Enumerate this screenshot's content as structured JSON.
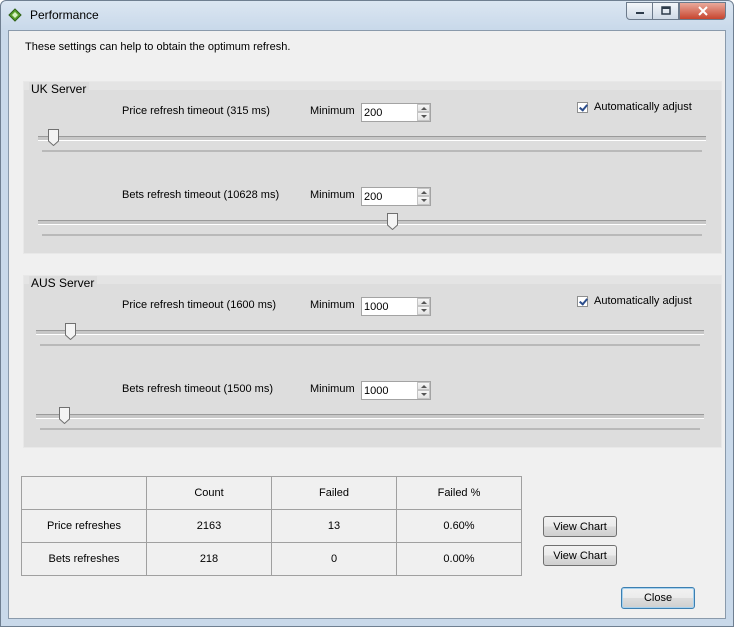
{
  "window": {
    "title": "Performance",
    "icon": "app-diamond-icon"
  },
  "intro_text": "These settings can help to obtain the optimum refresh.",
  "uk_server": {
    "title": "UK Server",
    "price": {
      "label": "Price refresh timeout (315 ms)",
      "min_label": "Minimum",
      "min_value": "200",
      "slider_fraction": 0.01
    },
    "bets": {
      "label": "Bets refresh timeout (10628 ms)",
      "min_label": "Minimum",
      "min_value": "200",
      "slider_fraction": 0.53
    },
    "auto_adjust": {
      "label": "Automatically adjust",
      "checked": true
    }
  },
  "aus_server": {
    "title": "AUS Server",
    "price": {
      "label": "Price refresh timeout (1600 ms)",
      "min_label": "Minimum",
      "min_value": "1000",
      "slider_fraction": 0.04
    },
    "bets": {
      "label": "Bets refresh timeout (1500 ms)",
      "min_label": "Minimum",
      "min_value": "1000",
      "slider_fraction": 0.03
    },
    "auto_adjust": {
      "label": "Automatically adjust",
      "checked": true
    }
  },
  "stats": {
    "headers": [
      "",
      "Count",
      "Failed",
      "Failed %"
    ],
    "rows": [
      {
        "name": "Price refreshes",
        "count": "2163",
        "failed": "13",
        "failed_pct": "0.60%"
      },
      {
        "name": "Bets refreshes",
        "count": "218",
        "failed": "0",
        "failed_pct": "0.00%"
      }
    ]
  },
  "buttons": {
    "view_chart": "View Chart",
    "close": "Close"
  },
  "colors": {
    "check_mark": "#2b4d8c",
    "close_caption": "#c7452f",
    "accent_border": "#3c7fb1"
  }
}
